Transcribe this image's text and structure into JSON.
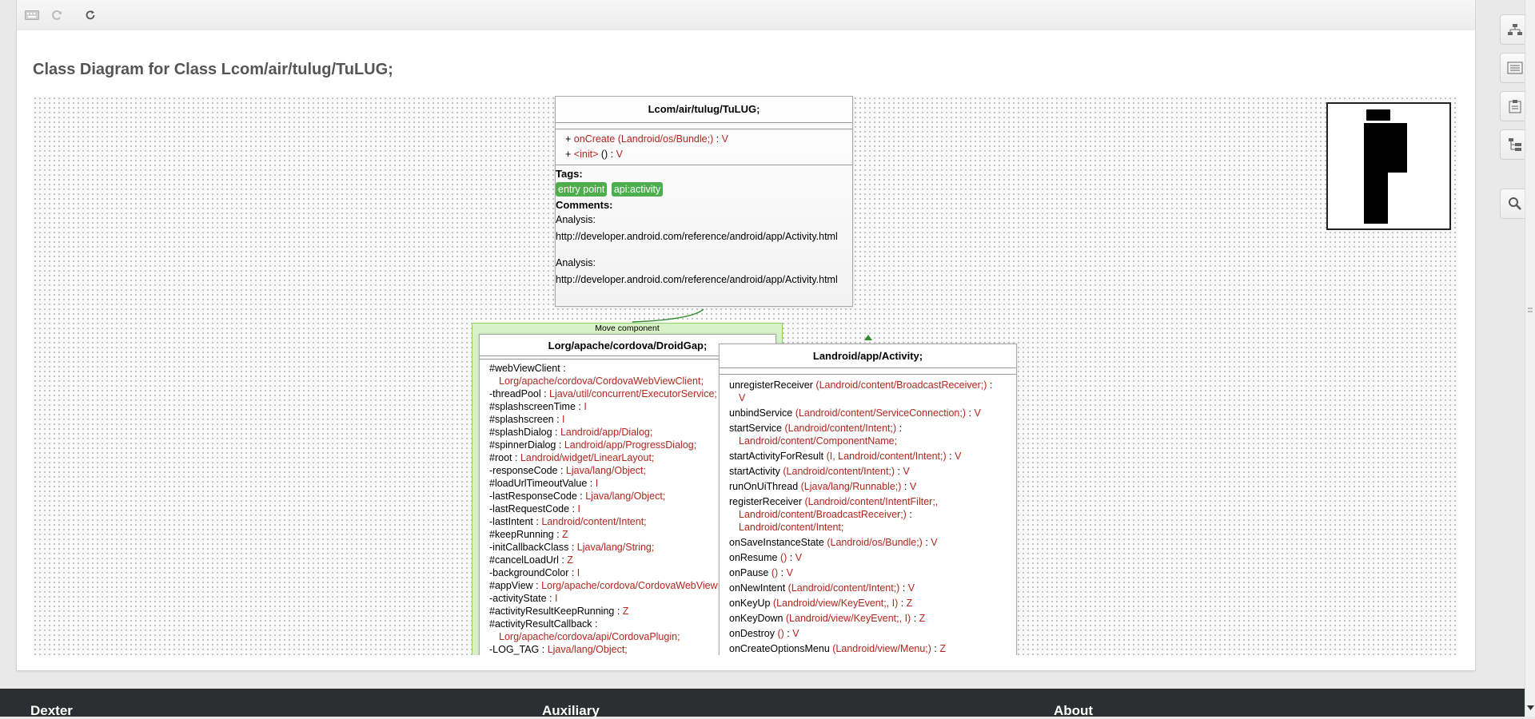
{
  "page": {
    "title": "Class Diagram for Class Lcom/air/tulug/TuLUG;"
  },
  "toolbar": {
    "buttons": [
      {
        "icon": "keyboard-icon"
      },
      {
        "icon": "redo-icon"
      },
      {
        "icon": "refresh-icon"
      }
    ]
  },
  "diagram": {
    "main_class": {
      "title": "Lcom/air/tulug/TuLUG;",
      "methods": [
        {
          "vis": "+",
          "name": "onCreate",
          "params": "(Landroid/os/Bundle;)",
          "ret": "V"
        },
        {
          "vis": "+",
          "name": "<init>",
          "params": "()",
          "ret": "V"
        }
      ],
      "tags_label": "Tags:",
      "tags": [
        "entry point",
        "api:activity"
      ],
      "comments_label": "Comments:",
      "comments": [
        {
          "label": "Analysis:",
          "url": "http://developer.android.com/reference/android/app/Activity.html"
        },
        {
          "label": "Analysis:",
          "url": "http://developer.android.com/reference/android/app/Activity.html"
        }
      ]
    },
    "droidgap": {
      "component_label": "Move component",
      "title": "Lorg/apache/cordova/DroidGap;",
      "fields": [
        {
          "name": "#webViewClient",
          "type": "Lorg/apache/cordova/CordovaWebViewClient;",
          "wrap": true
        },
        {
          "name": "-threadPool",
          "type": "Ljava/util/concurrent/ExecutorService;"
        },
        {
          "name": "#splashscreenTime",
          "type": "I"
        },
        {
          "name": "#splashscreen",
          "type": "I"
        },
        {
          "name": "#splashDialog",
          "type": "Landroid/app/Dialog;"
        },
        {
          "name": "#spinnerDialog",
          "type": "Landroid/app/ProgressDialog;"
        },
        {
          "name": "#root",
          "type": "Landroid/widget/LinearLayout;"
        },
        {
          "name": "-responseCode",
          "type": "Ljava/lang/Object;"
        },
        {
          "name": "#loadUrlTimeoutValue",
          "type": "I"
        },
        {
          "name": "-lastResponseCode",
          "type": "Ljava/lang/Object;"
        },
        {
          "name": "-lastRequestCode",
          "type": "I"
        },
        {
          "name": "-lastIntent",
          "type": "Landroid/content/Intent;"
        },
        {
          "name": "#keepRunning",
          "type": "Z"
        },
        {
          "name": "-initCallbackClass",
          "type": "Ljava/lang/String;"
        },
        {
          "name": "#cancelLoadUrl",
          "type": "Z"
        },
        {
          "name": "-backgroundColor",
          "type": "I"
        },
        {
          "name": "#appView",
          "type": "Lorg/apache/cordova/CordovaWebView;"
        },
        {
          "name": "-activityState",
          "type": "I"
        },
        {
          "name": "#activityResultKeepRunning",
          "type": "Z"
        },
        {
          "name": "#activityResultCallback",
          "type": "Lorg/apache/cordova/api/CordovaPlugin;",
          "wrap": true
        },
        {
          "name": "-LOG_TAG",
          "type": "Ljava/lang/Object;"
        }
      ]
    },
    "activity": {
      "title": "Landroid/app/Activity;",
      "methods": [
        {
          "name": "unregisterReceiver",
          "params": "(Landroid/content/BroadcastReceiver;)",
          "ret": "V",
          "wrap": true
        },
        {
          "name": "unbindService",
          "params": "(Landroid/content/ServiceConnection;)",
          "ret": "V"
        },
        {
          "name": "startService",
          "params": "(Landroid/content/Intent;)",
          "ret": "Landroid/content/ComponentName;",
          "wrap": true
        },
        {
          "name": "startActivityForResult",
          "params": "(I, Landroid/content/Intent;)",
          "ret": "V"
        },
        {
          "name": "startActivity",
          "params": "(Landroid/content/Intent;)",
          "ret": "V"
        },
        {
          "name": "runOnUiThread",
          "params": "(Ljava/lang/Runnable;)",
          "ret": "V"
        },
        {
          "name": "registerReceiver",
          "params": "(Landroid/content/IntentFilter;,",
          "params2": "Landroid/content/BroadcastReceiver;)",
          "ret": "Landroid/content/Intent;",
          "three": true
        },
        {
          "name": "onSaveInstanceState",
          "params": "(Landroid/os/Bundle;)",
          "ret": "V"
        },
        {
          "name": "onResume",
          "params": "()",
          "ret": "V"
        },
        {
          "name": "onPause",
          "params": "()",
          "ret": "V"
        },
        {
          "name": "onNewIntent",
          "params": "(Landroid/content/Intent;)",
          "ret": "V"
        },
        {
          "name": "onKeyUp",
          "params": "(Landroid/view/KeyEvent;, I)",
          "ret": "Z"
        },
        {
          "name": "onKeyDown",
          "params": "(Landroid/view/KeyEvent;, I)",
          "ret": "Z"
        },
        {
          "name": "onDestroy",
          "params": "()",
          "ret": "V"
        },
        {
          "name": "onCreateOptionsMenu",
          "params": "(Landroid/view/Menu;)",
          "ret": "Z"
        }
      ]
    }
  },
  "sidebar": {
    "buttons": [
      {
        "icon": "hierarchy-icon"
      },
      {
        "icon": "list-icon"
      },
      {
        "icon": "clipboard-icon"
      },
      {
        "icon": "tree-icon"
      },
      {
        "icon": "search-icon"
      }
    ]
  },
  "footer": {
    "columns": [
      "Dexter",
      "Auxiliary",
      "About"
    ]
  },
  "colors": {
    "accent_red": "#b3261e",
    "tag_green": "#4cae4c",
    "component_green": "#8fd36f",
    "footer_bg": "#2b2f30"
  }
}
